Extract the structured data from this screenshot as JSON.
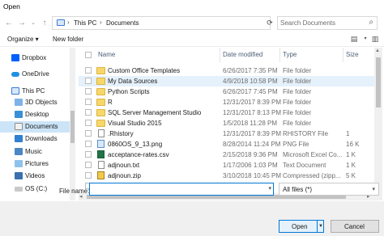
{
  "window": {
    "title": "Open"
  },
  "address": {
    "crumbs": [
      "This PC",
      "Documents"
    ],
    "search_placeholder": "Search Documents"
  },
  "toolbar": {
    "organize": "Organize ▾",
    "new_folder": "New folder"
  },
  "nav": {
    "items": [
      {
        "label": "Dropbox",
        "icon": "dropbox-icon"
      },
      {
        "label": "OneDrive",
        "icon": "onedrive-icon"
      },
      {
        "label": "This PC",
        "icon": "computer-icon"
      },
      {
        "label": "3D Objects",
        "icon": "3d-objects-icon"
      },
      {
        "label": "Desktop",
        "icon": "desktop-icon"
      },
      {
        "label": "Documents",
        "icon": "documents-icon",
        "selected": true
      },
      {
        "label": "Downloads",
        "icon": "downloads-icon"
      },
      {
        "label": "Music",
        "icon": "music-icon"
      },
      {
        "label": "Pictures",
        "icon": "pictures-icon"
      },
      {
        "label": "Videos",
        "icon": "videos-icon"
      },
      {
        "label": "OS (C:)",
        "icon": "drive-icon"
      }
    ]
  },
  "columns": {
    "name": "Name",
    "date": "Date modified",
    "type": "Type",
    "size": "Size"
  },
  "files": [
    {
      "name": "Custom Office Templates",
      "date": "6/26/2017 7:35 PM",
      "type": "File folder",
      "size": "",
      "icon": "folder-icon"
    },
    {
      "name": "My Data Sources",
      "date": "4/9/2018 10:58 PM",
      "type": "File folder",
      "size": "",
      "icon": "folder-icon"
    },
    {
      "name": "Python Scripts",
      "date": "6/26/2017 7:45 PM",
      "type": "File folder",
      "size": "",
      "icon": "folder-icon"
    },
    {
      "name": "R",
      "date": "12/31/2017 8:39 PM",
      "type": "File folder",
      "size": "",
      "icon": "folder-icon"
    },
    {
      "name": "SQL Server Management Studio",
      "date": "12/31/2017 8:13 PM",
      "type": "File folder",
      "size": "",
      "icon": "folder-icon"
    },
    {
      "name": "Visual Studio 2015",
      "date": "1/5/2018 11:28 PM",
      "type": "File folder",
      "size": "",
      "icon": "folder-icon"
    },
    {
      "name": ".Rhistory",
      "date": "12/31/2017 8:39 PM",
      "type": "RHISTORY File",
      "size": "1",
      "icon": "document-icon"
    },
    {
      "name": "0860OS_9_13.png",
      "date": "8/28/2014 11:24 PM",
      "type": "PNG File",
      "size": "16 K",
      "icon": "image-icon"
    },
    {
      "name": "acceptance-rates.csv",
      "date": "2/15/2018 9:36 PM",
      "type": "Microsoft Excel Co...",
      "size": "1 K",
      "icon": "excel-icon"
    },
    {
      "name": "adjnoun.txt",
      "date": "1/17/2006 1:03 PM",
      "type": "Text Document",
      "size": "1 K",
      "icon": "document-icon"
    },
    {
      "name": "adjnoun.zip",
      "date": "3/10/2018 10:45 PM",
      "type": "Compressed (zipp...",
      "size": "5 K",
      "icon": "zip-icon"
    },
    {
      "name": "",
      "date": "",
      "type": "",
      "size": "",
      "icon": "folder-icon"
    }
  ],
  "bottom": {
    "file_name_label": "File name:",
    "file_name_value": "",
    "filter": "All files (*)",
    "open": "Open",
    "cancel": "Cancel"
  }
}
